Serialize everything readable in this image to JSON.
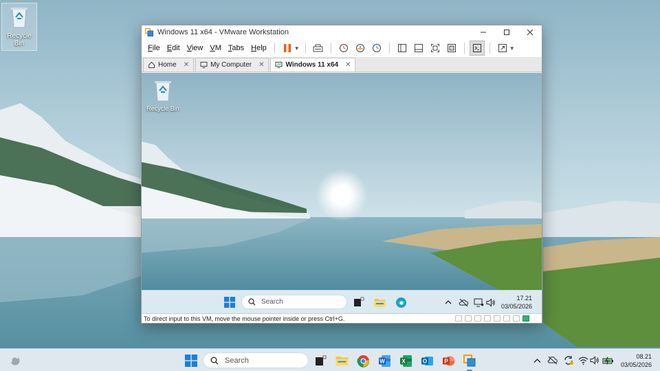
{
  "host": {
    "desktop_icons": [
      {
        "label": "Recycle Bin",
        "icon": "recycle-bin-icon"
      }
    ],
    "taskbar": {
      "search_placeholder": "Search",
      "apps": [
        {
          "name": "Windows Start",
          "icon": "windows-start-icon"
        },
        {
          "name": "Task View",
          "icon": "task-view-icon"
        },
        {
          "name": "File Explorer",
          "icon": "file-explorer-icon"
        },
        {
          "name": "Google Chrome",
          "icon": "chrome-icon"
        },
        {
          "name": "Microsoft Word",
          "icon": "word-icon"
        },
        {
          "name": "Microsoft Excel",
          "icon": "excel-icon"
        },
        {
          "name": "Microsoft Outlook",
          "icon": "outlook-icon"
        },
        {
          "name": "Microsoft PowerPoint",
          "icon": "powerpoint-icon"
        },
        {
          "name": "VMware Workstation",
          "icon": "vmware-icon"
        }
      ],
      "time": "08.21",
      "date": "03/05/2026"
    }
  },
  "vmware": {
    "title": "Windows 11 x64 - VMware Workstation",
    "menu": [
      {
        "label": "File",
        "accel": "F",
        "rest": "ile"
      },
      {
        "label": "Edit",
        "accel": "E",
        "rest": "dit"
      },
      {
        "label": "View",
        "accel": "V",
        "rest": "iew"
      },
      {
        "label": "VM",
        "accel": "V",
        "rest": "M"
      },
      {
        "label": "Tabs",
        "accel": "T",
        "rest": "abs"
      },
      {
        "label": "Help",
        "accel": "H",
        "rest": "elp"
      }
    ],
    "tabs": [
      {
        "label": "Home",
        "icon": "home-icon",
        "active": false
      },
      {
        "label": "My Computer",
        "icon": "monitor-icon",
        "active": false
      },
      {
        "label": "Windows 11 x64",
        "icon": "vm-icon",
        "active": true
      }
    ],
    "status_message": "To direct input to this VM, move the mouse pointer inside or press Ctrl+G.",
    "colors": {
      "pause_accent": "#e8641a",
      "status_green": "#2bb673"
    }
  },
  "guest": {
    "desktop_icons": [
      {
        "label": "Recycle Bin",
        "icon": "recycle-bin-icon"
      }
    ],
    "taskbar": {
      "search_placeholder": "Search",
      "time": "17.21",
      "date": "03/05/2026"
    }
  }
}
